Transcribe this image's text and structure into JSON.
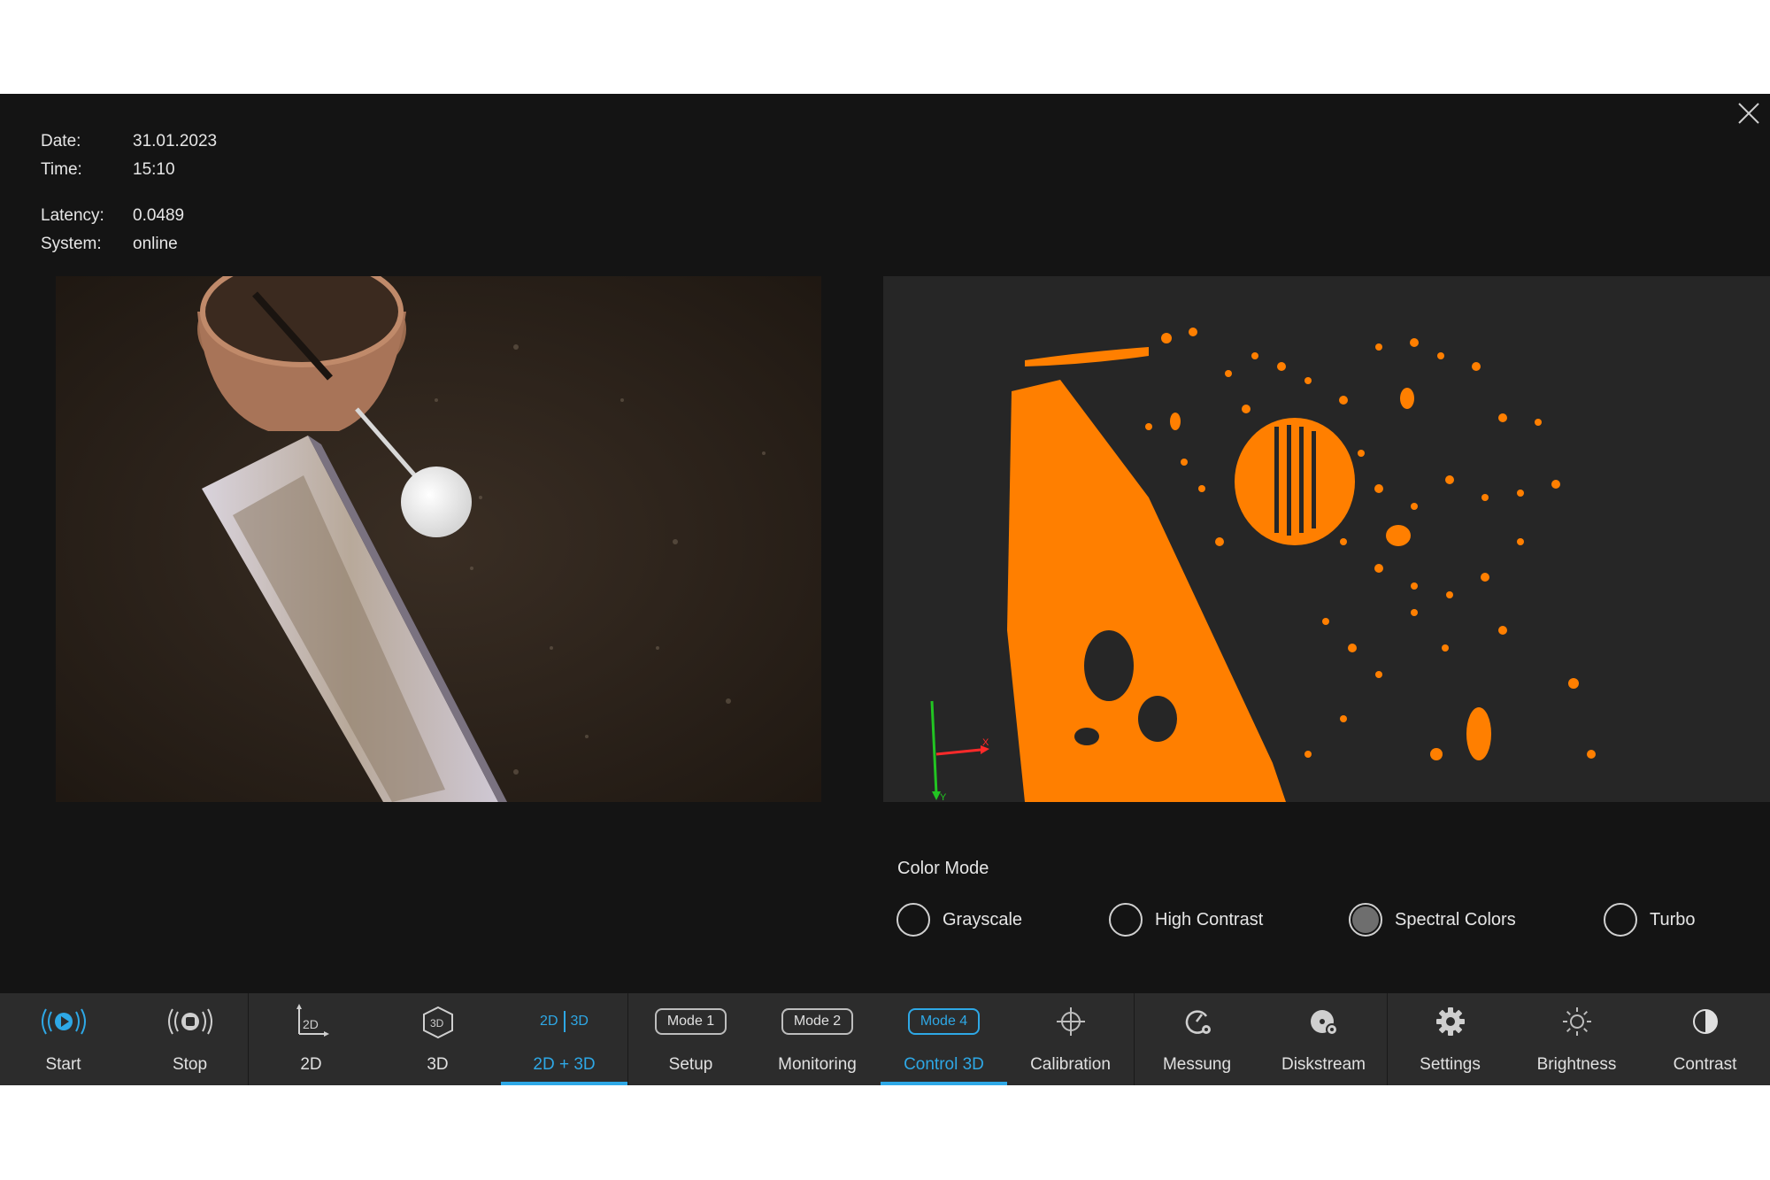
{
  "info": {
    "date_label": "Date:",
    "date_value": "31.01.2023",
    "time_label": "Time:",
    "time_value": "15:10",
    "latency_label": "Latency:",
    "latency_value": "0.0489",
    "system_label": "System:",
    "system_value": "online"
  },
  "axes": {
    "x_label": "X",
    "y_label": "Y"
  },
  "color_mode": {
    "label": "Color Mode",
    "options": [
      "Grayscale",
      "High Contrast",
      "Spectral Colors",
      "Turbo"
    ],
    "selected": "Spectral Colors"
  },
  "toolbar": {
    "active_color": "#2ea8e6",
    "items": [
      {
        "label": "Start",
        "icon": "play-circle-icon",
        "active": true
      },
      {
        "label": "Stop",
        "icon": "stop-circle-icon",
        "active": false
      },
      {
        "label": "2D",
        "icon": "2d-axes-icon",
        "icon_text": "2D",
        "active": false
      },
      {
        "label": "3D",
        "icon": "3d-cube-icon",
        "icon_text": "3D",
        "active": false
      },
      {
        "label": "2D + 3D",
        "icon": "2d-3d-icon",
        "icon_text_a": "2D",
        "icon_text_b": "3D",
        "active": true
      },
      {
        "label": "Setup",
        "pill": "Mode 1",
        "active": false
      },
      {
        "label": "Monitoring",
        "pill": "Mode 2",
        "active": false
      },
      {
        "label": "Control 3D",
        "pill": "Mode 4",
        "active": true
      },
      {
        "label": "Calibration",
        "icon": "crosshair-icon",
        "active": false
      },
      {
        "label": "Messung",
        "icon": "gauge-icon",
        "active": false
      },
      {
        "label": "Diskstream",
        "icon": "disk-icon",
        "active": false
      },
      {
        "label": "Settings",
        "icon": "gear-icon",
        "active": false
      },
      {
        "label": "Brightness",
        "icon": "sun-icon",
        "active": false
      },
      {
        "label": "Contrast",
        "icon": "contrast-icon",
        "active": false
      }
    ]
  }
}
